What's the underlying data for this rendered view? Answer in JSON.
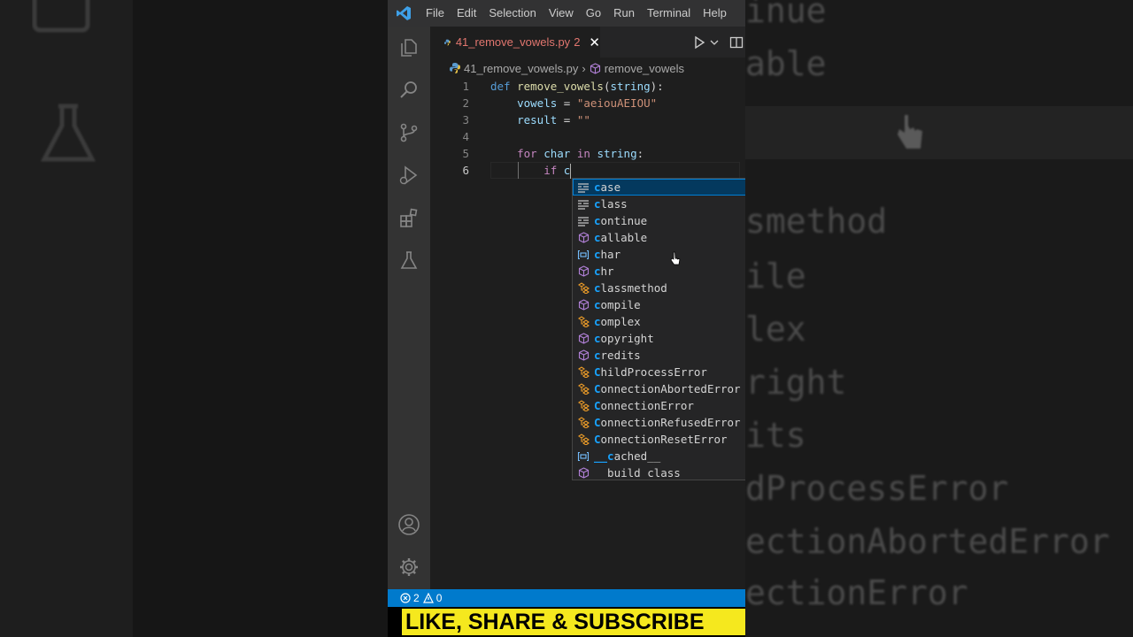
{
  "menu": [
    "File",
    "Edit",
    "Selection",
    "View",
    "Go",
    "Run",
    "Terminal",
    "Help"
  ],
  "tab": {
    "label": "41_remove_vowels.py",
    "problems": "2",
    "close": "✕"
  },
  "breadcrumb": {
    "file": "41_remove_vowels.py",
    "symbol": "remove_vowels"
  },
  "code_lines": [
    {
      "num": "1",
      "tokens": [
        [
          "kw",
          "def "
        ],
        [
          "fn",
          "remove_vowels"
        ],
        [
          "op",
          "("
        ],
        [
          "var",
          "string"
        ],
        [
          "op",
          "):"
        ]
      ]
    },
    {
      "num": "2",
      "tokens": [
        [
          "op",
          "    "
        ],
        [
          "var",
          "vowels"
        ],
        [
          "op",
          " = "
        ],
        [
          "str",
          "\"aeiouAEIOU\""
        ]
      ]
    },
    {
      "num": "3",
      "tokens": [
        [
          "op",
          "    "
        ],
        [
          "var",
          "result"
        ],
        [
          "op",
          " = "
        ],
        [
          "str",
          "\"\""
        ]
      ]
    },
    {
      "num": "4",
      "tokens": []
    },
    {
      "num": "5",
      "tokens": [
        [
          "op",
          "    "
        ],
        [
          "kw2",
          "for "
        ],
        [
          "var",
          "char"
        ],
        [
          "kw2",
          " in "
        ],
        [
          "var",
          "string"
        ],
        [
          "op",
          ":"
        ]
      ]
    },
    {
      "num": "6",
      "tokens": [
        [
          "op",
          "        "
        ],
        [
          "kw2",
          "if "
        ],
        [
          "var",
          "c"
        ]
      ]
    }
  ],
  "suggestions": [
    {
      "kind": "keyword",
      "match": "c",
      "rest": "ase"
    },
    {
      "kind": "keyword",
      "match": "c",
      "rest": "lass"
    },
    {
      "kind": "keyword",
      "match": "c",
      "rest": "ontinue"
    },
    {
      "kind": "function",
      "match": "c",
      "rest": "allable"
    },
    {
      "kind": "variable",
      "match": "c",
      "rest": "har"
    },
    {
      "kind": "function",
      "match": "c",
      "rest": "hr"
    },
    {
      "kind": "class",
      "match": "c",
      "rest": "lassmethod"
    },
    {
      "kind": "function",
      "match": "c",
      "rest": "ompile"
    },
    {
      "kind": "class",
      "match": "c",
      "rest": "omplex"
    },
    {
      "kind": "function",
      "match": "c",
      "rest": "opyright"
    },
    {
      "kind": "function",
      "match": "c",
      "rest": "redits"
    },
    {
      "kind": "class",
      "match": "C",
      "rest": "hildProcessError"
    },
    {
      "kind": "class",
      "match": "C",
      "rest": "onnectionAbortedError"
    },
    {
      "kind": "class",
      "match": "C",
      "rest": "onnectionError"
    },
    {
      "kind": "class",
      "match": "C",
      "rest": "onnectionRefusedError"
    },
    {
      "kind": "class",
      "match": "C",
      "rest": "onnectionResetError"
    },
    {
      "kind": "variable",
      "match": "__c",
      "rest": "ached__"
    },
    {
      "kind": "function",
      "match": "",
      "rest": "  build class"
    }
  ],
  "status": {
    "errors": "2",
    "warnings": "0"
  },
  "banner": "LIKE, SHARE & SUBSCRIBE",
  "background_words": [
    "inue",
    "able",
    "smethod",
    "ile",
    "lex",
    "right",
    "its",
    "dProcessError",
    "ectionAbortedError",
    "ectionError"
  ],
  "colors": {
    "accent": "#007acc",
    "banner": "#f5e81e",
    "selection": "#04395e"
  }
}
